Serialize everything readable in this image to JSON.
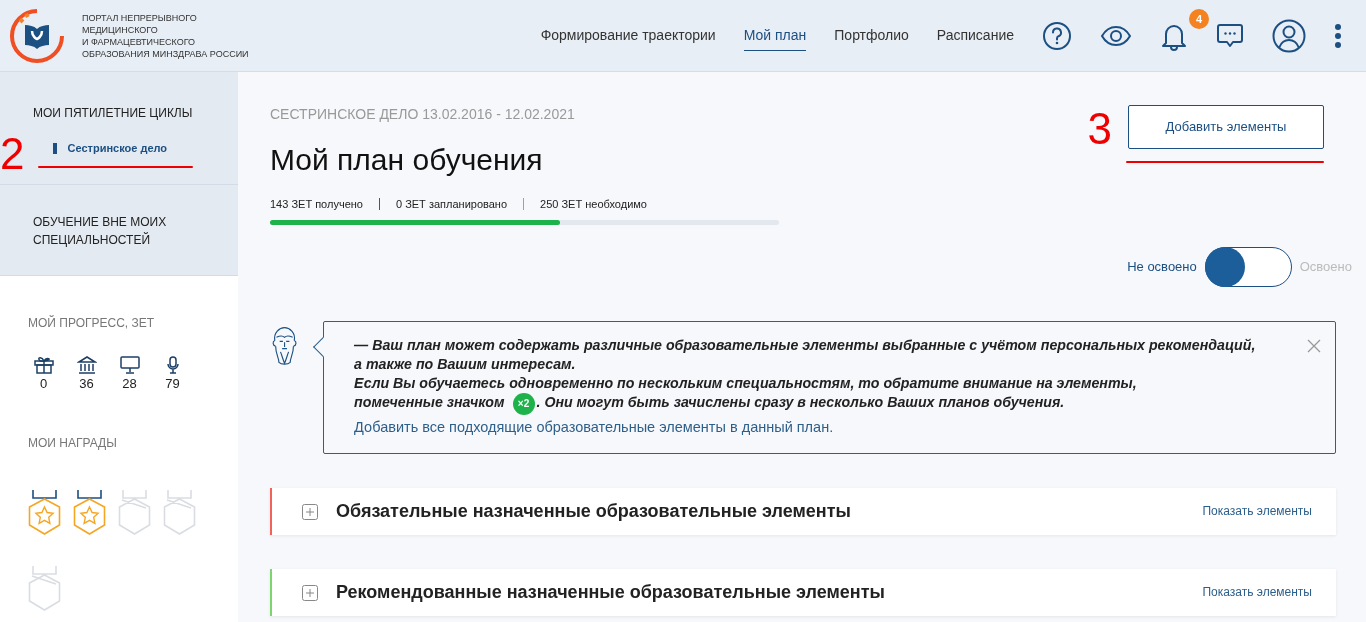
{
  "logo": {
    "lines": [
      "ПОРТАЛ НЕПРЕРЫВНОГО",
      "МЕДИЦИНСКОГО",
      "И ФАРМАЦЕВТИЧЕСКОГО",
      "ОБРАЗОВАНИЯ МИНЗДРАВА РОССИИ"
    ]
  },
  "nav": [
    {
      "label": "Формирование траектории",
      "selected": false
    },
    {
      "label": "Мой план",
      "selected": true
    },
    {
      "label": "Портфолио",
      "selected": false
    },
    {
      "label": "Расписание",
      "selected": false
    }
  ],
  "header_icons": [
    {
      "kind": "help"
    },
    {
      "kind": "eye"
    },
    {
      "kind": "bell",
      "badge": "4"
    },
    {
      "kind": "chat"
    },
    {
      "kind": "user"
    },
    {
      "kind": "more"
    }
  ],
  "sidebar": {
    "sections": [
      {
        "title": "МОИ ПЯТИЛЕТНИЕ ЦИКЛЫ",
        "items": [
          {
            "label": "Сестринское дело",
            "selected": true,
            "annotation": "2"
          }
        ]
      },
      {
        "title": "ОБУЧЕНИЕ ВНЕ МОИХ СПЕЦИАЛЬНОСТЕЙ"
      }
    ],
    "progress_title": "МОЙ ПРОГРЕСС, ЗЕТ",
    "progress": [
      {
        "kind": "gift",
        "value": "0"
      },
      {
        "kind": "bank",
        "value": "36"
      },
      {
        "kind": "monitor",
        "value": "28"
      },
      {
        "kind": "mic",
        "value": "79"
      }
    ],
    "awards_title": "МОИ НАГРАДЫ",
    "awards": [
      {
        "earned": true
      },
      {
        "earned": true
      },
      {
        "earned": false
      },
      {
        "earned": false
      },
      {
        "earned": false
      }
    ]
  },
  "main": {
    "subtitle": "СЕСТРИНСКОЕ ДЕЛО 13.02.2016 - 12.02.2021",
    "title": "Мой план обучения",
    "add_button": {
      "label": "Добавить элементы",
      "annotation": "3"
    },
    "stats": [
      "143 ЗЕТ получено",
      "0 ЗЕТ запланировано",
      "250 ЗЕТ необходимо"
    ],
    "progress": {
      "level": 0.57
    },
    "toggle": {
      "off_label": "Не освоено",
      "on_label": "Освоено",
      "on": false
    },
    "notice": {
      "line1": "— Ваш план может содержать различные образовательные элементы выбранные с учётом персональных рекомендаций, а также по Вашим интересам.",
      "line2": "Если Вы обучаетесь одновременно по нескольким специальностям, то обратите внимание на элементы,",
      "line3_before": "помеченные значком",
      "badge": "×2",
      "line3_after": ". Они могут быть зачислены сразу в несколько Ваших планов обучения.",
      "link": "Добавить все подходящие образовательные элементы в данный план."
    },
    "sections": [
      {
        "title": "Обязательные назначенные образовательные элементы",
        "link": "Показать элементы",
        "color": "#f0625a"
      },
      {
        "title": "Рекомендованные назначенные образовательные элементы",
        "link": "Показать элементы",
        "color": "#7ed56f"
      }
    ]
  }
}
